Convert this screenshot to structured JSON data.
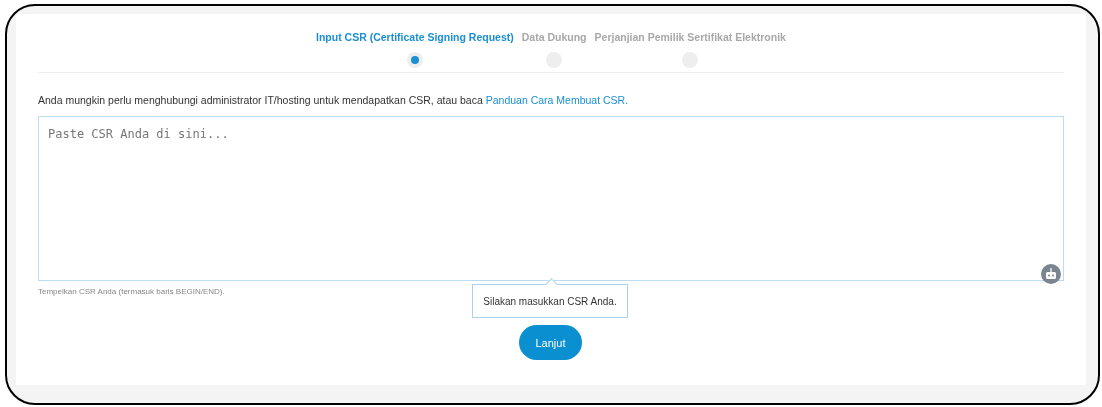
{
  "steps": [
    {
      "label": "Input CSR (Certificate Signing Request)",
      "selected": true
    },
    {
      "label": "Data Dukung",
      "selected": false
    },
    {
      "label": "Perjanjian Pemilik Sertifikat Elektronik",
      "selected": false
    }
  ],
  "intro": {
    "text": "Anda mungkin perlu menghubungi administrator IT/hosting untuk mendapatkan CSR, atau baca",
    "link": "Panduan Cara Membuat CSR."
  },
  "csr_field": {
    "placeholder": "Paste CSR Anda di sini...",
    "help": "Tempelkan CSR Anda (termasuk baris BEGIN/END)."
  },
  "tooltip": "Silakan masukkan CSR Anda.",
  "submit_button": "Lanjut"
}
